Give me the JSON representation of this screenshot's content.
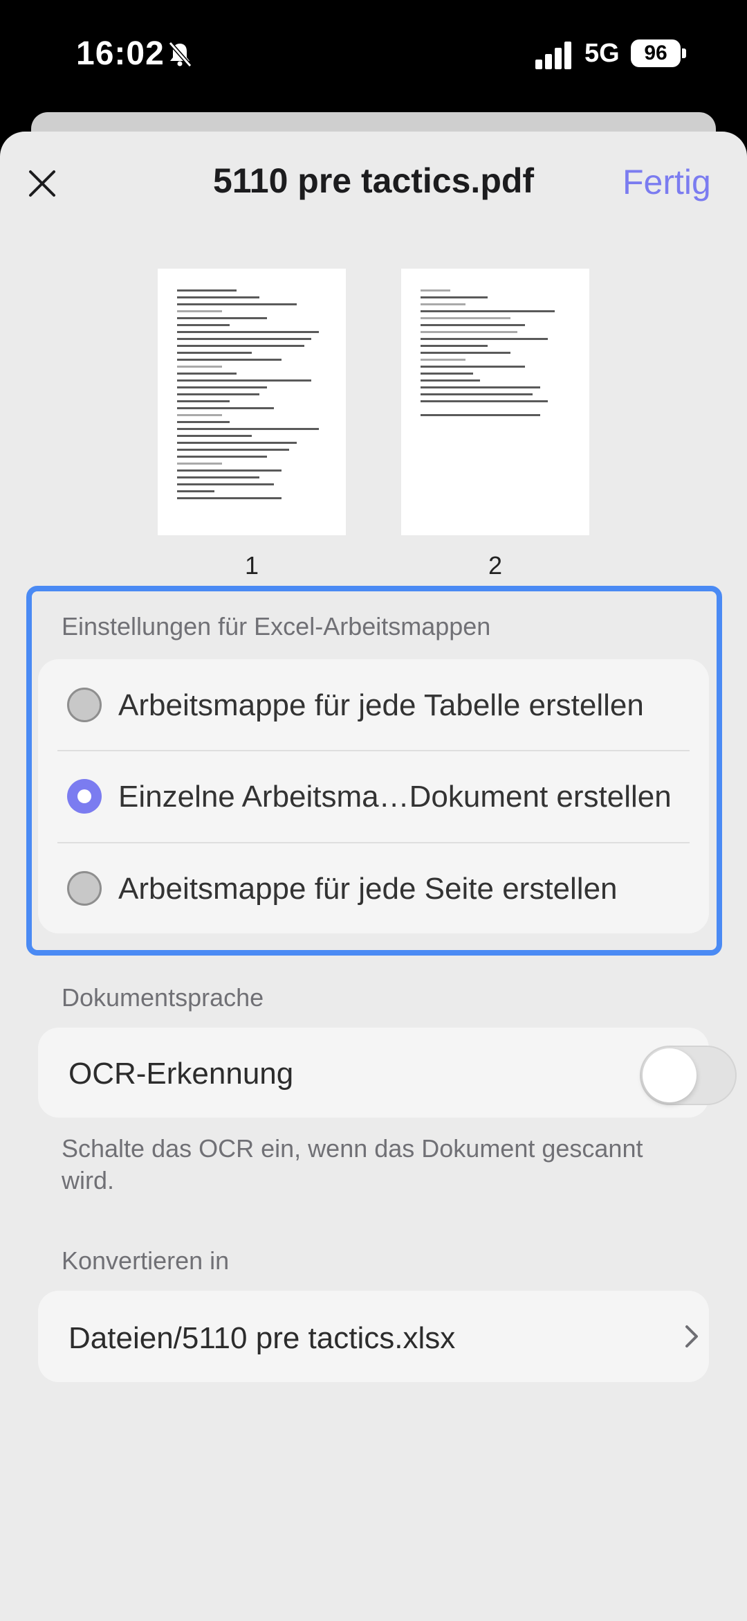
{
  "status_bar": {
    "time": "16:02",
    "network": "5G",
    "battery": "96"
  },
  "header": {
    "title": "5110 pre tactics.pdf",
    "done_label": "Fertig"
  },
  "pages": [
    {
      "number": "1"
    },
    {
      "number": "2"
    }
  ],
  "excel_settings": {
    "section_label": "Einstellungen für Excel-Arbeitsmappen",
    "options": [
      {
        "label": "Arbeitsmappe für jede Tabelle erstellen",
        "selected": false
      },
      {
        "label": "Einzelne Arbeitsma…Dokument erstellen",
        "selected": true
      },
      {
        "label": "Arbeitsmappe für jede Seite erstellen",
        "selected": false
      }
    ]
  },
  "document_language": {
    "section_label": "Dokumentsprache",
    "ocr_label": "OCR-Erkennung",
    "ocr_enabled": false,
    "hint": "Schalte das OCR ein, wenn das Dokument gescannt wird."
  },
  "convert": {
    "section_label": "Konvertieren in",
    "destination": "Dateien/5110 pre tactics.xlsx"
  },
  "colors": {
    "accent": "#7b7cf0",
    "highlight_border": "#4a8af4",
    "sheet_background": "#ebebeb"
  }
}
